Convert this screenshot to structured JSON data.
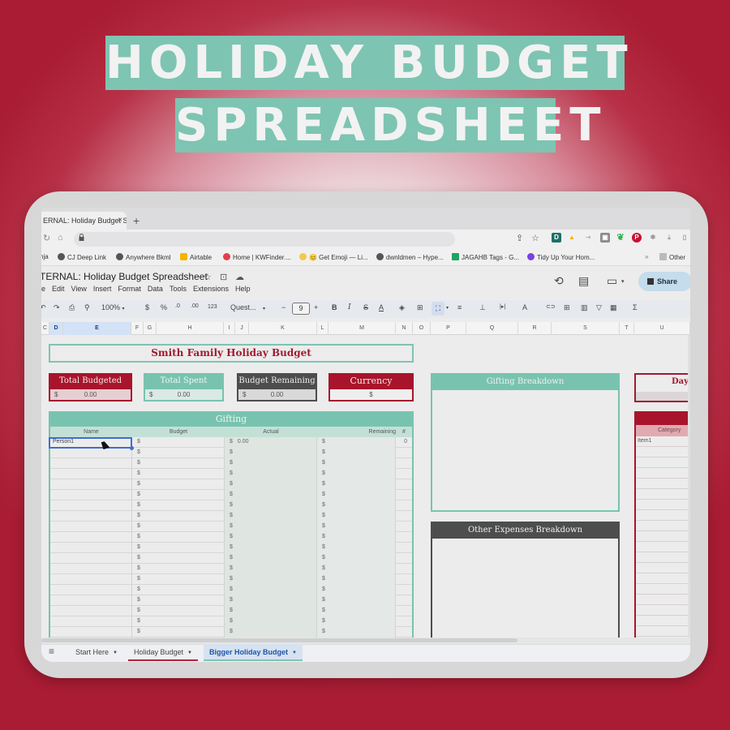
{
  "hero": {
    "line1": "HOLIDAY BUDGET",
    "line2": "SPREADSHEET"
  },
  "browser": {
    "tab_title": "ERNAL: Holiday Budget Sp",
    "tab_close": "×",
    "new_tab": "+",
    "reload_icon": "↻",
    "home_icon": "⌂",
    "lock_icon": "🔒",
    "share_page_icon": "⇪",
    "bookmark_star_icon": "☆",
    "extensions": [
      "D",
      "▲",
      "⇢",
      "▣",
      "❦",
      "P",
      "✱",
      "⤓",
      "▯"
    ],
    "bookmarks": [
      {
        "label": "nja",
        "color": ""
      },
      {
        "label": "CJ Deep Link",
        "color": "#555555"
      },
      {
        "label": "Anywhere Bkml",
        "color": "#555555"
      },
      {
        "label": "Airtable",
        "color": "#f4b400"
      },
      {
        "label": "Home | KWFinder....",
        "color": "#e0404c"
      },
      {
        "label": "😊 Get Emoji — Li...",
        "color": "#f2c94c"
      },
      {
        "label": "dwnldmen – Hype...",
        "color": "#555555"
      },
      {
        "label": "JAGAHB Tags - G...",
        "color": "#1fa463"
      },
      {
        "label": "Tidy Up Your Hom...",
        "color": "#7b3fe4"
      }
    ],
    "bookmarks_more": "»",
    "other_bookmarks": "Other"
  },
  "sheets": {
    "doc_title": "TERNAL: Holiday Budget Spreadsheet",
    "star_icon": "☆",
    "move_icon": "⊡",
    "cloud_icon": "☁",
    "menu": [
      "e",
      "Edit",
      "View",
      "Insert",
      "Format",
      "Data",
      "Tools",
      "Extensions",
      "Help"
    ],
    "history_icon": "⟲",
    "comment_icon": "▤",
    "meet_icon": "▭",
    "share_label": "Share",
    "toolbar": {
      "undo": "↶",
      "redo": "↷",
      "print": "⎙",
      "paint_format": "⚲",
      "zoom": "100%",
      "currency": "$",
      "percent": "%",
      "dec_decrease": ".0",
      "dec_increase": ".00",
      "more_formats": "123",
      "font": "Quest...",
      "font_minus": "−",
      "font_size": "9",
      "font_plus": "+",
      "bold": "B",
      "italic": "I",
      "strike": "S",
      "text_color": "A",
      "fill": "◈",
      "borders": "⊞",
      "merge": "⛶",
      "h_align": "≡",
      "v_align": "⊥",
      "wrap": "|▸|",
      "rotate": "A",
      "link": "⊂⊃",
      "comment": "⊞",
      "chart": "▥",
      "filter": "▽",
      "filter_views": "▦",
      "functions": "Σ",
      "dropdown": "▾"
    },
    "columns": [
      "C",
      "D",
      "E",
      "F",
      "G",
      "H",
      "I",
      "J",
      "K",
      "L",
      "M",
      "N",
      "O",
      "P",
      "Q",
      "R",
      "S",
      "T",
      "U"
    ]
  },
  "budget": {
    "title": "Smith Family Holiday Budget",
    "cards": [
      {
        "label": "Total Budgeted",
        "symbol": "$",
        "value": "0.00"
      },
      {
        "label": "Total Spent",
        "symbol": "$",
        "value": "0.00"
      },
      {
        "label": "Budget Remaining",
        "symbol": "$",
        "value": "0.00"
      },
      {
        "label": "Currency",
        "symbol": "",
        "value": "$"
      }
    ],
    "gifting": {
      "title": "Gifting",
      "headers": [
        "Name",
        "Budget",
        "Actual",
        "Remaining",
        "#"
      ],
      "rows": [
        {
          "name": "Person1",
          "budget": "$",
          "actual": "$",
          "actual_value": "0.00",
          "remaining": "$",
          "count": "0"
        },
        {
          "name": "",
          "budget": "$",
          "actual": "$",
          "actual_value": "",
          "remaining": "$",
          "count": ""
        },
        {
          "name": "",
          "budget": "$",
          "actual": "$",
          "actual_value": "",
          "remaining": "$",
          "count": ""
        },
        {
          "name": "",
          "budget": "$",
          "actual": "$",
          "actual_value": "",
          "remaining": "$",
          "count": ""
        },
        {
          "name": "",
          "budget": "$",
          "actual": "$",
          "actual_value": "",
          "remaining": "$",
          "count": ""
        },
        {
          "name": "",
          "budget": "$",
          "actual": "$",
          "actual_value": "",
          "remaining": "$",
          "count": ""
        },
        {
          "name": "",
          "budget": "$",
          "actual": "$",
          "actual_value": "",
          "remaining": "$",
          "count": ""
        },
        {
          "name": "",
          "budget": "$",
          "actual": "$",
          "actual_value": "",
          "remaining": "$",
          "count": ""
        },
        {
          "name": "",
          "budget": "$",
          "actual": "$",
          "actual_value": "",
          "remaining": "$",
          "count": ""
        },
        {
          "name": "",
          "budget": "$",
          "actual": "$",
          "actual_value": "",
          "remaining": "$",
          "count": ""
        },
        {
          "name": "",
          "budget": "$",
          "actual": "$",
          "actual_value": "",
          "remaining": "$",
          "count": ""
        },
        {
          "name": "",
          "budget": "$",
          "actual": "$",
          "actual_value": "",
          "remaining": "$",
          "count": ""
        },
        {
          "name": "",
          "budget": "$",
          "actual": "$",
          "actual_value": "",
          "remaining": "$",
          "count": ""
        },
        {
          "name": "",
          "budget": "$",
          "actual": "$",
          "actual_value": "",
          "remaining": "$",
          "count": ""
        },
        {
          "name": "",
          "budget": "$",
          "actual": "$",
          "actual_value": "",
          "remaining": "$",
          "count": ""
        },
        {
          "name": "",
          "budget": "$",
          "actual": "$",
          "actual_value": "",
          "remaining": "$",
          "count": ""
        },
        {
          "name": "",
          "budget": "$",
          "actual": "$",
          "actual_value": "",
          "remaining": "$",
          "count": ""
        },
        {
          "name": "",
          "budget": "$",
          "actual": "$",
          "actual_value": "",
          "remaining": "$",
          "count": ""
        },
        {
          "name": "",
          "budget": "$",
          "actual": "$",
          "actual_value": "",
          "remaining": "$",
          "count": ""
        }
      ]
    },
    "gifting_breakdown_title": "Gifting Breakdown",
    "other_expenses_breakdown_title": "Other Expenses Breakdown",
    "days_label": "Days",
    "other_expenses": {
      "header": "Category",
      "rows": [
        "Item1",
        "",
        "",
        "",
        "",
        "",
        "",
        "",
        "",
        "",
        "",
        "",
        "",
        "",
        "",
        "",
        "",
        "",
        ""
      ]
    }
  },
  "sheet_tabs": [
    {
      "label": "Start Here"
    },
    {
      "label": "Holiday Budget"
    },
    {
      "label": "Bigger Holiday Budget"
    }
  ],
  "sheet_tabs_menu_icon": "≡",
  "colors": {
    "teal": "#7ec4b2",
    "red": "#a8142b",
    "dark_gray": "#4d4d4d",
    "selection_blue": "#3e6fd0"
  }
}
